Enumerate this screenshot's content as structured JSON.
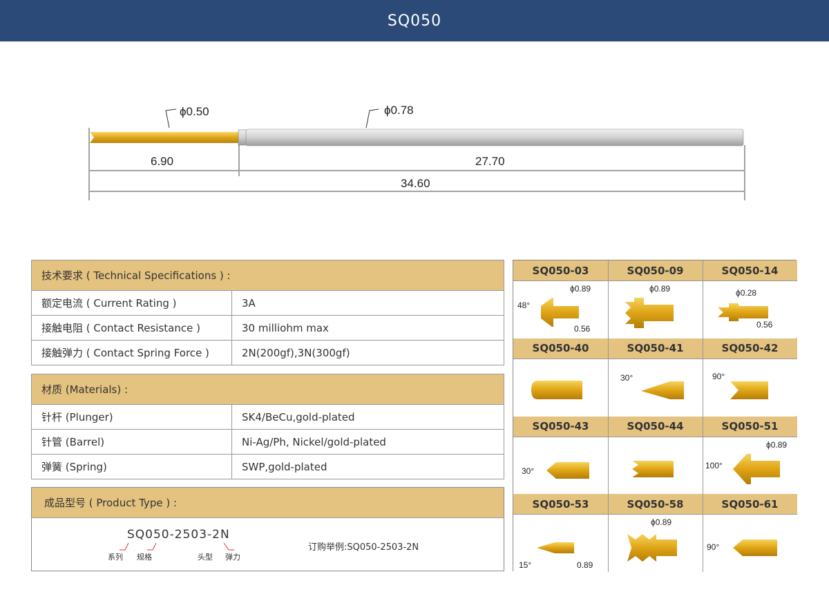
{
  "header": {
    "title": "SQ050"
  },
  "drawing": {
    "plunger_diameter": "ϕ0.50",
    "barrel_diameter": "ϕ0.78",
    "plunger_length": "6.90",
    "barrel_length": "27.70",
    "total_length": "34.60"
  },
  "tech": {
    "heading": "技术要求 ( Technical Specifications ) :",
    "rows": [
      {
        "key": "额定电流 ( Current Rating )",
        "value": "3A"
      },
      {
        "key": "接触电阻 ( Contact Resistance )",
        "value": "30 milliohm max"
      },
      {
        "key": "接触弹力 ( Contact Spring Force )",
        "value": "2N(200gf),3N(300gf)"
      }
    ]
  },
  "materials": {
    "heading": "材质 (Materials) :",
    "rows": [
      {
        "key": "针杆 (Plunger)",
        "value": "SK4/BeCu,gold-plated"
      },
      {
        "key": "针管 (Barrel)",
        "value": "Ni-Ag/Ph,  Nickel/gold-plated"
      },
      {
        "key": "弹簧 (Spring)",
        "value": "SWP,gold-plated"
      }
    ]
  },
  "product": {
    "heading": "成品型号 ( Product Type ) :",
    "code": "SQ050-2503-2N",
    "parts": [
      "系列",
      "规格",
      "头型",
      "弹力"
    ],
    "example": "订购举例:SQ050-2503-2N"
  },
  "tips": [
    {
      "label": "SQ050-03",
      "notes": [
        "48°",
        "ϕ0.89",
        "0.56"
      ]
    },
    {
      "label": "SQ050-09",
      "notes": [
        "ϕ0.89"
      ]
    },
    {
      "label": "SQ050-14",
      "notes": [
        "ϕ0.28",
        "0.56"
      ]
    },
    {
      "label": "SQ050-40",
      "notes": []
    },
    {
      "label": "SQ050-41",
      "notes": [
        "30°"
      ]
    },
    {
      "label": "SQ050-42",
      "notes": [
        "90°"
      ]
    },
    {
      "label": "SQ050-43",
      "notes": [
        "30°"
      ]
    },
    {
      "label": "SQ050-44",
      "notes": []
    },
    {
      "label": "SQ050-51",
      "notes": [
        "ϕ0.89",
        "100°"
      ]
    },
    {
      "label": "SQ050-53",
      "notes": [
        "15°",
        "0.89"
      ]
    },
    {
      "label": "SQ050-58",
      "notes": [
        "ϕ0.89"
      ]
    },
    {
      "label": "SQ050-61",
      "notes": [
        "90°"
      ]
    }
  ]
}
